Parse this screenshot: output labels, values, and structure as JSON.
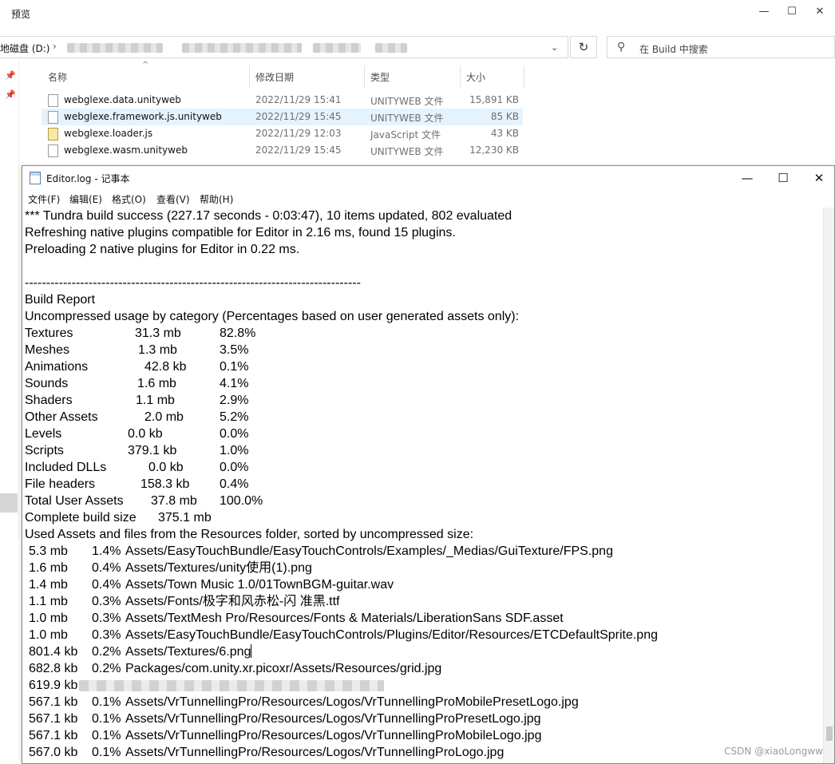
{
  "explorer": {
    "title": "预览",
    "address_drive": "地磁盘 (D:)",
    "address_sep": "›",
    "search_placeholder": "在 Build 中搜索",
    "columns": {
      "name": "名称",
      "date": "修改日期",
      "type": "类型",
      "size": "大小"
    },
    "files": [
      {
        "name": "webglexe.data.unityweb",
        "date": "2022/11/29 15:41",
        "type": "UNITYWEB 文件",
        "size": "15,891 KB",
        "selected": false,
        "icon": "file-icon"
      },
      {
        "name": "webglexe.framework.js.unityweb",
        "date": "2022/11/29 15:45",
        "type": "UNITYWEB 文件",
        "size": "85 KB",
        "selected": true,
        "icon": "file-icon"
      },
      {
        "name": "webglexe.loader.js",
        "date": "2022/11/29 12:03",
        "type": "JavaScript 文件",
        "size": "43 KB",
        "selected": false,
        "icon": "js-file-icon"
      },
      {
        "name": "webglexe.wasm.unityweb",
        "date": "2022/11/29 15:45",
        "type": "UNITYWEB 文件",
        "size": "12,230 KB",
        "selected": false,
        "icon": "file-icon"
      }
    ]
  },
  "notepad": {
    "title": "Editor.log - 记事本",
    "menu": [
      "文件(F)",
      "编辑(E)",
      "格式(O)",
      "查看(V)",
      "帮助(H)"
    ],
    "lines": [
      "*** Tundra build success (227.17 seconds - 0:03:47), 10 items updated, 802 evaluated",
      "Refreshing native plugins compatible for Editor in 2.16 ms, found 15 plugins.",
      "Preloading 2 native plugins for Editor in 0.22 ms.",
      "",
      "-------------------------------------------------------------------------------",
      "Build Report",
      "Uncompressed usage by category (Percentages based on user generated assets only):"
    ],
    "categories": [
      {
        "label": "Textures",
        "size": "31.3 mb",
        "pct": "82.8%"
      },
      {
        "label": "Meshes",
        "size": "1.3 mb",
        "pct": "3.5%"
      },
      {
        "label": "Animations",
        "size": "42.8 kb",
        "pct": "0.1%"
      },
      {
        "label": "Sounds",
        "size": "1.6 mb",
        "pct": "4.1%"
      },
      {
        "label": "Shaders",
        "size": "1.1 mb",
        "pct": "2.9%"
      },
      {
        "label": "Other Assets",
        "size": "2.0 mb",
        "pct": "5.2%"
      },
      {
        "label": "Levels",
        "size": "0.0 kb",
        "pct": "0.0%"
      },
      {
        "label": "Scripts",
        "size": "379.1 kb",
        "pct": "1.0%"
      },
      {
        "label": "Included DLLs",
        "size": "0.0 kb",
        "pct": "0.0%"
      },
      {
        "label": "File headers",
        "size": "158.3 kb",
        "pct": "0.4%"
      },
      {
        "label": "Total User Assets",
        "size": "37.8 mb",
        "pct": "100.0%"
      }
    ],
    "complete_label": "Complete build size",
    "complete_size": "375.1 mb",
    "used_assets_header": "Used Assets and files from the Resources folder, sorted by uncompressed size:",
    "assets": [
      {
        "size": "5.3 mb",
        "pct": "1.4%",
        "path": "Assets/EasyTouchBundle/EasyTouchControls/Examples/_Medias/GuiTexture/FPS.png"
      },
      {
        "size": "1.6 mb",
        "pct": "0.4%",
        "path": "Assets/Textures/unity使用(1).png"
      },
      {
        "size": "1.4 mb",
        "pct": "0.4%",
        "path": "Assets/Town Music 1.0/01TownBGM-guitar.wav"
      },
      {
        "size": "1.1 mb",
        "pct": "0.3%",
        "path": "Assets/Fonts/极字和风赤松-闪 准黑.ttf"
      },
      {
        "size": "1.0 mb",
        "pct": "0.3%",
        "path": "Assets/TextMesh Pro/Resources/Fonts & Materials/LiberationSans SDF.asset"
      },
      {
        "size": "1.0 mb",
        "pct": "0.3%",
        "path": "Assets/EasyTouchBundle/EasyTouchControls/Plugins/Editor/Resources/ETCDefaultSprite.png"
      },
      {
        "size": "801.4 kb",
        "pct": "0.2%",
        "path": "Assets/Textures/6.png"
      },
      {
        "size": "682.8 kb",
        "pct": "0.2%",
        "path": "Packages/com.unity.xr.picoxr/Assets/Resources/grid.jpg"
      },
      {
        "size": "619.9 kb",
        "pct": "",
        "path": ""
      },
      {
        "size": "567.1 kb",
        "pct": "0.1%",
        "path": "Assets/VrTunnellingPro/Resources/Logos/VrTunnellingProMobilePresetLogo.jpg"
      },
      {
        "size": "567.1 kb",
        "pct": "0.1%",
        "path": "Assets/VrTunnellingPro/Resources/Logos/VrTunnellingProPresetLogo.jpg"
      },
      {
        "size": "567.1 kb",
        "pct": "0.1%",
        "path": "Assets/VrTunnellingPro/Resources/Logos/VrTunnellingProMobileLogo.jpg"
      },
      {
        "size": "567.0 kb",
        "pct": "0.1%",
        "path": "Assets/VrTunnellingPro/Resources/Logos/VrTunnellingProLogo.jpg"
      }
    ]
  },
  "watermark": "CSDN @xiaoLongww"
}
